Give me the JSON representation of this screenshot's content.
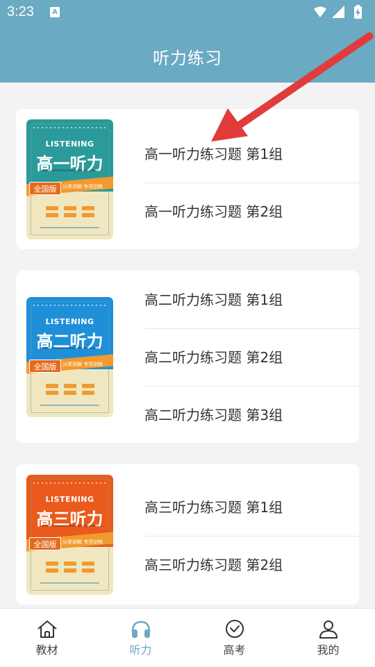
{
  "status_bar": {
    "time": "3:23",
    "notification_icon_letter": "A",
    "icons": [
      "wifi-icon",
      "signal-icon",
      "battery-icon"
    ]
  },
  "header": {
    "title": "听力练习"
  },
  "sections": [
    {
      "cover": {
        "english": "LISTENING",
        "title": "高一听力",
        "badge": "全国版",
        "ribbon": "分类讲解 专项训练",
        "color": "#2b9a9a"
      },
      "items": [
        {
          "label": "高一听力练习题",
          "group": "第1组"
        },
        {
          "label": "高一听力练习题",
          "group": "第2组"
        }
      ]
    },
    {
      "cover": {
        "english": "LISTENING",
        "title": "高二听力",
        "badge": "全国版",
        "ribbon": "分类讲解 专项训练",
        "color": "#1f90d8"
      },
      "items": [
        {
          "label": "高二听力练习题",
          "group": "第1组"
        },
        {
          "label": "高二听力练习题",
          "group": "第2组"
        },
        {
          "label": "高二听力练习题",
          "group": "第3组"
        }
      ]
    },
    {
      "cover": {
        "english": "LISTENING",
        "title": "高三听力",
        "badge": "全国版",
        "ribbon": "分类讲解 专项训练",
        "color": "#ea5a1c"
      },
      "items": [
        {
          "label": "高三听力练习题",
          "group": "第1组"
        },
        {
          "label": "高三听力练习题",
          "group": "第2组"
        }
      ]
    }
  ],
  "tabbar": [
    {
      "label": "教材",
      "icon": "home-icon",
      "active": false
    },
    {
      "label": "听力",
      "icon": "headphones-icon",
      "active": true
    },
    {
      "label": "高考",
      "icon": "check-circle-icon",
      "active": false
    },
    {
      "label": "我的",
      "icon": "user-icon",
      "active": false
    }
  ],
  "colors": {
    "primary": "#6aaac2",
    "annotation_arrow": "#e03c3c"
  }
}
